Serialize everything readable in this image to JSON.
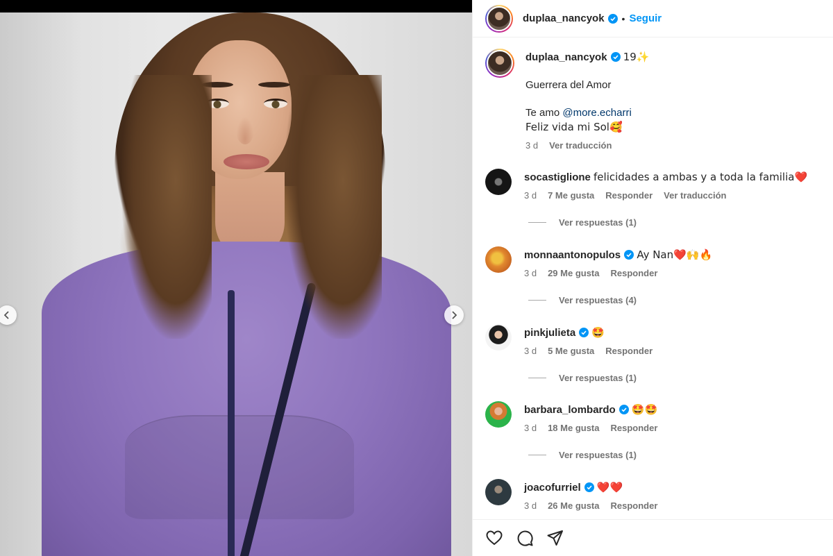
{
  "post": {
    "author": "duplaa_nancyok",
    "follow_label": "Seguir",
    "separator": "•"
  },
  "caption": {
    "username": "duplaa_nancyok",
    "text_1": "19✨",
    "line_2": "Guerrera del Amor",
    "line_3_prefix": "Te amo ",
    "mention": "@more.echarri",
    "line_4": "Feliz vida mi Sol🥰",
    "time": "3 d",
    "translate": "Ver traducción"
  },
  "comments": [
    {
      "username": "socastiglione",
      "verified": false,
      "text": "felicidades a ambas y a toda la familia❤️",
      "time": "3 d",
      "likes": "7 Me gusta",
      "reply": "Responder",
      "translate": "Ver traducción",
      "replies": "Ver respuestas (1)"
    },
    {
      "username": "monnaantonopulos",
      "verified": true,
      "text": "Ay Nan❤️🙌🔥",
      "time": "3 d",
      "likes": "29 Me gusta",
      "reply": "Responder",
      "replies": "Ver respuestas (4)"
    },
    {
      "username": "pinkjulieta",
      "verified": true,
      "text": "🤩",
      "time": "3 d",
      "likes": "5 Me gusta",
      "reply": "Responder",
      "replies": "Ver respuestas (1)"
    },
    {
      "username": "barbara_lombardo",
      "verified": true,
      "text": "🤩🤩",
      "time": "3 d",
      "likes": "18 Me gusta",
      "reply": "Responder",
      "replies": "Ver respuestas (1)"
    },
    {
      "username": "joacofurriel",
      "verified": true,
      "text": "❤️❤️",
      "time": "3 d",
      "likes": "26 Me gusta",
      "reply": "Responder"
    }
  ],
  "icons": {
    "verified": "verified-badge-icon",
    "like": "heart-outline-icon",
    "comment": "comment-bubble-icon",
    "share": "paper-plane-icon",
    "prev": "chevron-left-icon",
    "next": "chevron-right-icon"
  },
  "colors": {
    "accent": "#0095f6",
    "verified": "#0095f6",
    "mention": "#00376b",
    "secondary_text": "#737373"
  }
}
